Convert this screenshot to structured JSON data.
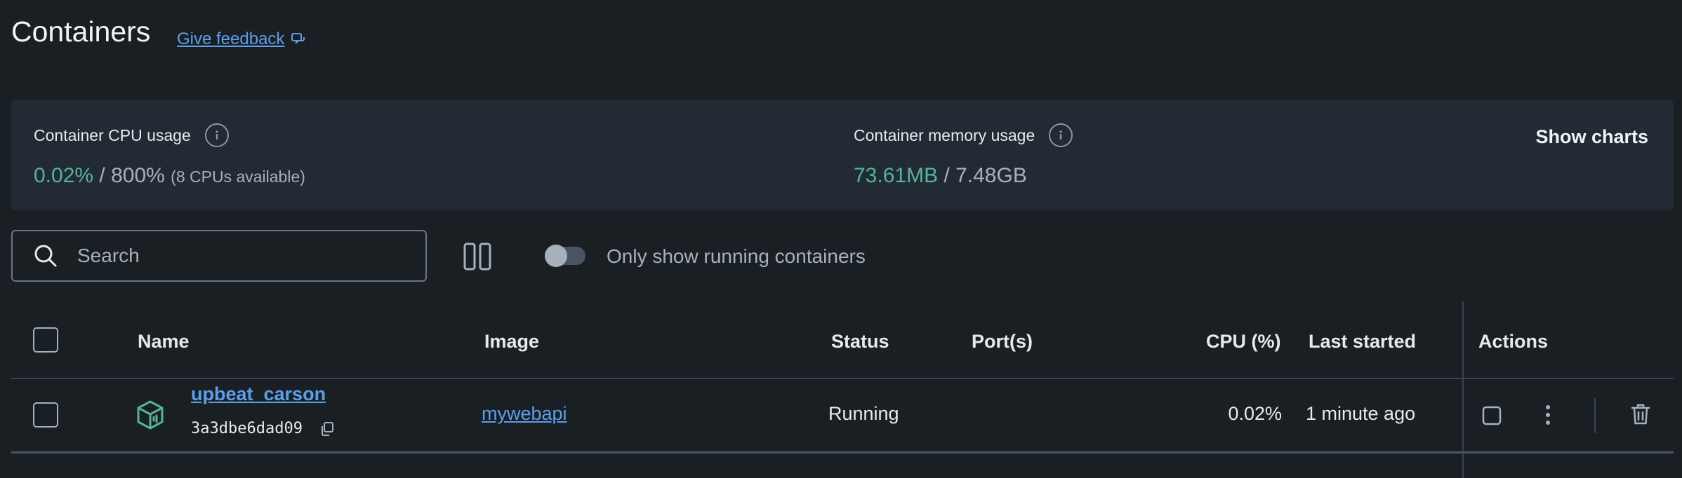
{
  "page": {
    "title": "Containers",
    "feedback_label": "Give feedback"
  },
  "stats": {
    "cpu": {
      "label": "Container CPU usage",
      "used": "0.02%",
      "separator": " / ",
      "total": "800%",
      "note": "(8 CPUs available)"
    },
    "memory": {
      "label": "Container memory usage",
      "used": "73.61MB",
      "separator": " / ",
      "total": "7.48GB"
    },
    "show_charts_label": "Show charts"
  },
  "toolbar": {
    "search_placeholder": "Search",
    "toggle_label": "Only show running containers",
    "toggle_on": false
  },
  "table": {
    "headers": {
      "name": "Name",
      "image": "Image",
      "status": "Status",
      "ports": "Port(s)",
      "cpu": "CPU (%)",
      "last_started": "Last started",
      "actions": "Actions"
    },
    "rows": [
      {
        "name": "upbeat_carson",
        "id": "3a3dbe6dad09",
        "image": "mywebapi",
        "status": "Running",
        "ports": "",
        "cpu": "0.02%",
        "last_started": "1 minute ago"
      }
    ]
  },
  "colors": {
    "background": "#1a1f24",
    "card": "#222a33",
    "accent_link": "#5c9ee8",
    "usage_green": "#54b399",
    "muted_text": "#a7b1bc"
  },
  "icons": {
    "feedback": "feedback-bubble-icon",
    "info": "info-icon",
    "search": "search-icon",
    "columns": "columns-icon",
    "container": "container-cube-icon",
    "copy": "copy-icon",
    "stop": "stop-icon",
    "more": "more-vertical-icon",
    "delete": "trash-icon"
  }
}
